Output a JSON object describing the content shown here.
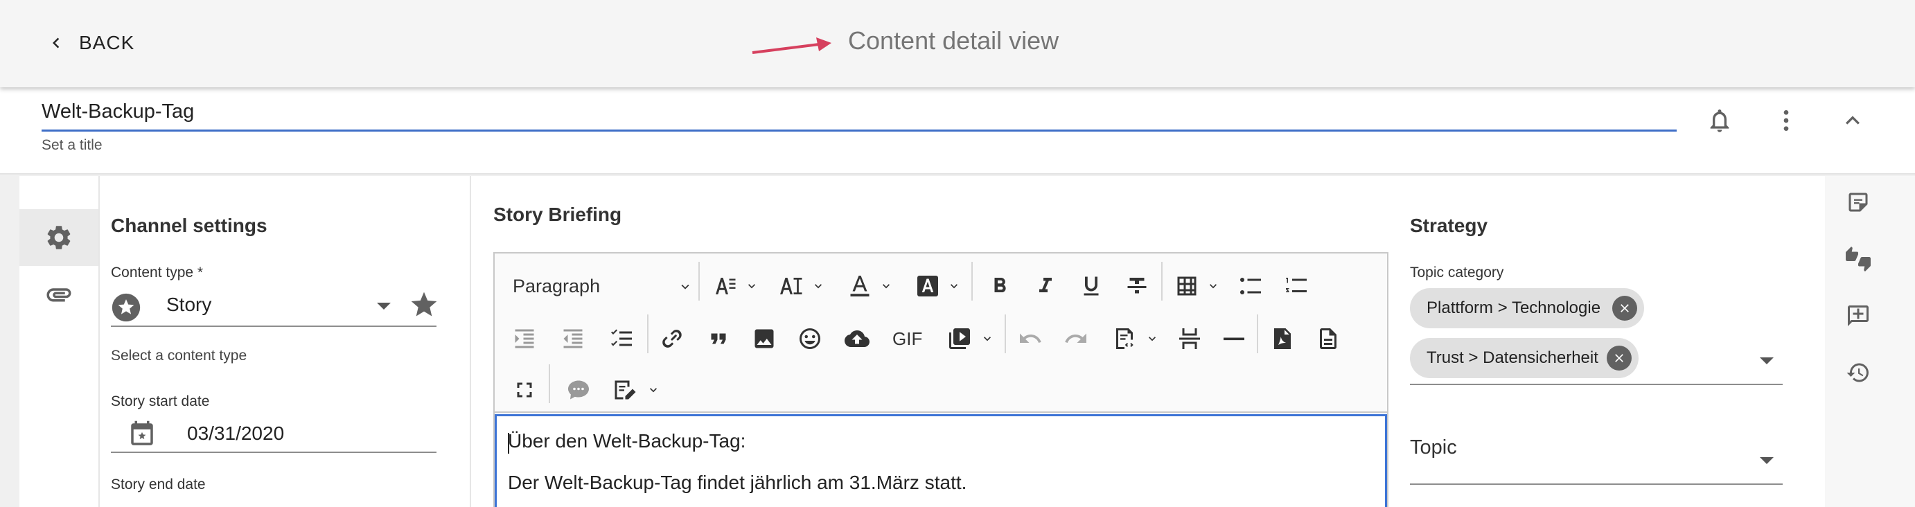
{
  "header": {
    "back_label": "BACK",
    "page_title": "Content detail view",
    "annotation_arrow_color": "#d6405e"
  },
  "titlebar": {
    "title_value": "Welt-Backup-Tag",
    "title_hint": "Set a title",
    "icons": [
      "bell-icon",
      "more-vert-icon",
      "chevron-up-icon"
    ]
  },
  "rail": {
    "items": [
      {
        "icon": "gear-icon",
        "active": true
      },
      {
        "icon": "paperclip-icon",
        "active": false
      }
    ]
  },
  "channel": {
    "section_title": "Channel settings",
    "content_type_label": "Content type *",
    "content_type_value": "Story",
    "content_type_hint": "Select a content type",
    "start_label": "Story start date",
    "start_value": "03/31/2020",
    "end_label": "Story end date"
  },
  "briefing": {
    "section_title": "Story Briefing",
    "paragraph_style": "Paragraph",
    "gif_label": "GIF",
    "content_lines": [
      "Über den Welt-Backup-Tag:",
      "Der Welt-Backup-Tag findet jährlich am 31.März statt."
    ]
  },
  "strategy": {
    "section_title": "Strategy",
    "topic_category_label": "Topic category",
    "chips": [
      "Plattform > Technologie",
      "Trust > Datensicherheit"
    ],
    "topic_label": "Topic"
  },
  "right_rail": {
    "icons": [
      "notes-icon",
      "thumbs-up-down-icon",
      "add-comment-icon",
      "history-icon"
    ]
  },
  "colors": {
    "accent_blue": "#3f6ec7",
    "chip_bg": "#e0e0e0",
    "chip_close": "#616161"
  }
}
